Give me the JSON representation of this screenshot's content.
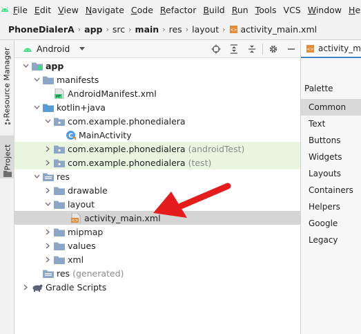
{
  "menubar": {
    "items": [
      {
        "label": "File",
        "mnemonic": "F",
        "rest": "ile"
      },
      {
        "label": "Edit",
        "mnemonic": "E",
        "rest": "dit"
      },
      {
        "label": "View",
        "mnemonic": "V",
        "rest": "iew"
      },
      {
        "label": "Navigate",
        "mnemonic": "N",
        "rest": "avigate"
      },
      {
        "label": "Code",
        "mnemonic": "C",
        "rest": "ode"
      },
      {
        "label": "Refactor",
        "mnemonic": "R",
        "rest": "efactor"
      },
      {
        "label": "Build",
        "mnemonic": "B",
        "rest": "uild"
      },
      {
        "label": "Run",
        "mnemonic": "R",
        "rest": "un"
      },
      {
        "label": "Tools",
        "mnemonic": "T",
        "rest": "ools"
      },
      {
        "label": "VCS",
        "mnemonic": "",
        "rest": "VCS"
      },
      {
        "label": "Window",
        "mnemonic": "W",
        "rest": "indow"
      },
      {
        "label": "Help",
        "mnemonic": "H",
        "rest": "elp"
      }
    ]
  },
  "breadcrumb": [
    "PhoneDialerA",
    "app",
    "src",
    "main",
    "res",
    "layout",
    "activity_main.xml"
  ],
  "left_strip": {
    "resource_manager": "Resource Manager",
    "project": "Project"
  },
  "project_panel": {
    "view_mode": "Android"
  },
  "tree": [
    {
      "label": "app",
      "suffix": ""
    },
    {
      "label": "manifests",
      "suffix": ""
    },
    {
      "label": "AndroidManifest.xml",
      "suffix": ""
    },
    {
      "label": "kotlin+java",
      "suffix": ""
    },
    {
      "label": "com.example.phonedialera",
      "suffix": ""
    },
    {
      "label": "MainActivity",
      "suffix": ""
    },
    {
      "label": "com.example.phonedialera",
      "suffix": "(androidTest)"
    },
    {
      "label": "com.example.phonedialera",
      "suffix": "(test)"
    },
    {
      "label": "res",
      "suffix": ""
    },
    {
      "label": "drawable",
      "suffix": ""
    },
    {
      "label": "layout",
      "suffix": ""
    },
    {
      "label": "activity_main.xml",
      "suffix": ""
    },
    {
      "label": "mipmap",
      "suffix": ""
    },
    {
      "label": "values",
      "suffix": ""
    },
    {
      "label": "xml",
      "suffix": ""
    },
    {
      "label": "res",
      "suffix": "(generated)"
    },
    {
      "label": "Gradle Scripts",
      "suffix": ""
    }
  ],
  "editor_tab": {
    "label": "activity_main.xml"
  },
  "palette": {
    "title": "Palette",
    "items": [
      "Common",
      "Text",
      "Buttons",
      "Widgets",
      "Layouts",
      "Containers",
      "Helpers",
      "Google",
      "Legacy"
    ]
  },
  "colors": {
    "folder": "#8ca7c6",
    "selection": "#d5d5d5",
    "test_highlight": "#e9f5e1",
    "arrow": "#e51c1c",
    "android_green": "#3ddc84",
    "tab_underline": "#4083c9"
  }
}
